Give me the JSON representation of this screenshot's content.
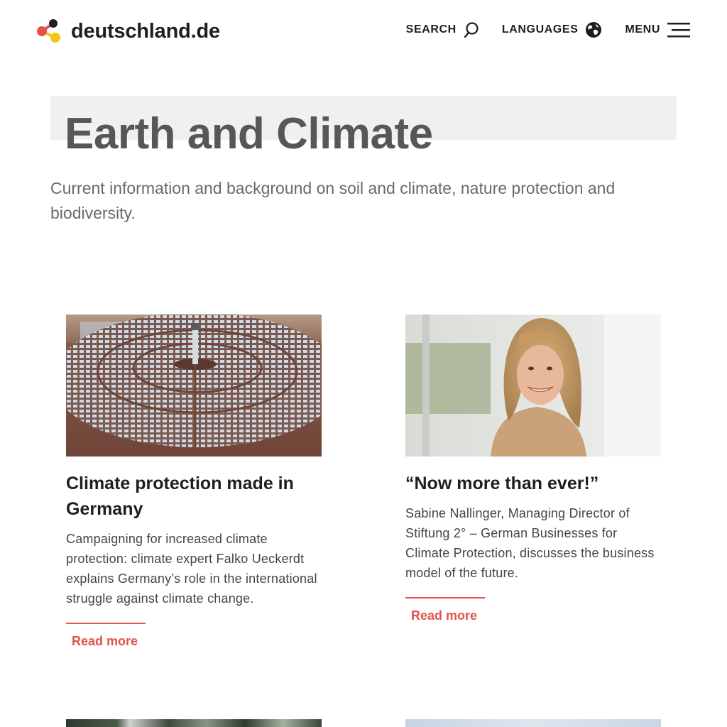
{
  "header": {
    "logo_text": "deutschland.de",
    "search_label": "SEARCH",
    "languages_label": "LANGUAGES",
    "menu_label": "MENU"
  },
  "hero": {
    "title": "Earth and Climate",
    "intro": "Current information and background on soil and climate, nature protection and biodiversity."
  },
  "cards": [
    {
      "title": "Climate protection made in Germany",
      "text": "Campaigning for increased climate protection: climate expert Falko Ueckerdt explains Germany’s role in the international struggle against climate change.",
      "read_more": "Read more"
    },
    {
      "title": "“Now more than ever!”",
      "text": "Sabine Nallinger, Managing Director of Stiftung 2° – German Businesses for Climate Protection, discusses the business model of the future.",
      "read_more": "Read more"
    }
  ],
  "colors": {
    "accent": "#e2534c",
    "title_gray": "#575757",
    "title_bar": "#f0f0f0",
    "logo_black": "#1e1e1e",
    "logo_red": "#e2534c",
    "logo_yellow": "#f5c518"
  },
  "icons": [
    "logo-molecule-icon",
    "search-icon",
    "globe-icon",
    "hamburger-menu-icon"
  ]
}
